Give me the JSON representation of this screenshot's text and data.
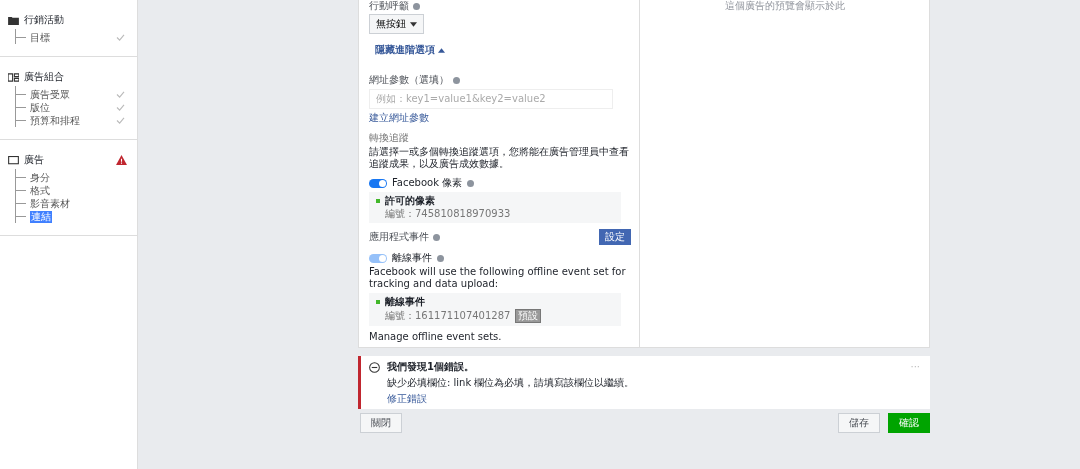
{
  "sidebar": {
    "sections": [
      {
        "title": "行銷活動",
        "warning": false,
        "items": [
          {
            "label": "目標",
            "done": true,
            "selected": false
          }
        ]
      },
      {
        "title": "廣告組合",
        "warning": false,
        "items": [
          {
            "label": "廣告受眾",
            "done": true,
            "selected": false
          },
          {
            "label": "版位",
            "done": true,
            "selected": false
          },
          {
            "label": "預算和排程",
            "done": true,
            "selected": false
          }
        ]
      },
      {
        "title": "廣告",
        "warning": true,
        "items": [
          {
            "label": "身分",
            "done": false,
            "selected": false
          },
          {
            "label": "格式",
            "done": false,
            "selected": false
          },
          {
            "label": "影音素材",
            "done": false,
            "selected": false
          },
          {
            "label": "連結",
            "done": false,
            "selected": true
          }
        ]
      }
    ]
  },
  "form": {
    "cta_label": "行動呼籲",
    "cta_value": "無按鈕",
    "advanced_toggle": "隱藏進階選項",
    "url_params_label": "網址參數（選填）",
    "url_params_placeholder": "例如：key1=value1&key2=value2",
    "build_link": "建立網址參數",
    "tracking_title": "轉換追蹤",
    "tracking_desc": "請選擇一或多個轉換追蹤選項，您將能在廣告管理員中查看追蹤成果，以及廣告成效數據。",
    "pixel": {
      "label": "Facebook 像素",
      "on": true,
      "disabled": false,
      "box_title": "許可的像素",
      "box_id": "編號：745810818970933"
    },
    "app_events": {
      "label": "應用程式事件",
      "button": "設定"
    },
    "offline": {
      "label": "離線事件",
      "on": true,
      "disabled": true,
      "note": "Facebook will use the following offline event set for tracking and data upload:",
      "box_title": "離線事件",
      "box_id": "編號：161171107401287",
      "badge": "預設"
    },
    "manage_link": "Manage offline event sets."
  },
  "preview": {
    "caption": "這個廣告的預覽會顯示於此"
  },
  "error": {
    "title": "我們發現1個錯誤。",
    "message": "缺少必填欄位: link 欄位為必填，請填寫該欄位以繼續。",
    "fix_link": "修正錯誤",
    "menu": "···"
  },
  "footer": {
    "close": "關閉",
    "save": "儲存",
    "confirm": "確認"
  }
}
